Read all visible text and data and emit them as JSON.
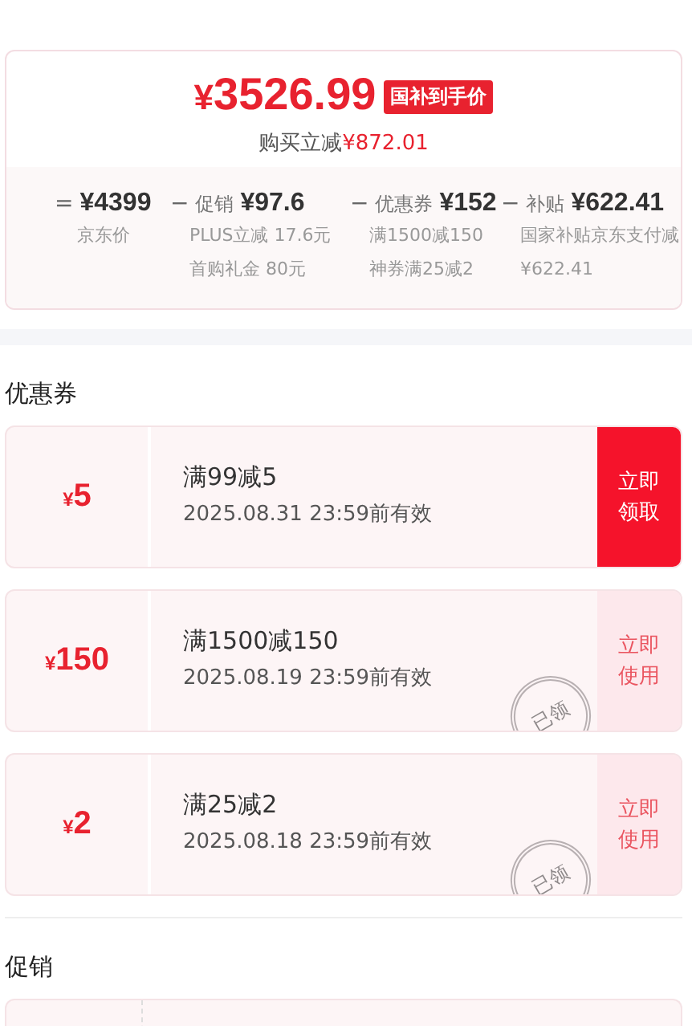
{
  "price": {
    "currency": "¥",
    "amount": "3526.99",
    "badge": "国补到手价",
    "saving_label": "购买立减",
    "saving_value": "¥872.01"
  },
  "breakdown": [
    {
      "operator": "=",
      "amount": "¥4399",
      "notes": [
        "京东价"
      ]
    },
    {
      "operator": "−",
      "label": "促销",
      "amount": "¥97.6",
      "notes": [
        "PLUS立减 17.6元",
        "首购礼金 80元"
      ]
    },
    {
      "operator": "−",
      "label": "优惠券",
      "amount": "¥152",
      "notes": [
        "满1500减150",
        "神券满25减2"
      ]
    },
    {
      "operator": "−",
      "label": "补贴",
      "amount": "¥622.41",
      "notes": [
        "国家补贴京东支付减¥622.41"
      ]
    }
  ],
  "coupons_section": {
    "title": "优惠券",
    "coupons": [
      {
        "currency": "¥",
        "value": "5",
        "condition": "满99减5",
        "validity": "2025.08.31  23:59前有效",
        "kind": "claim",
        "button": [
          "立即",
          "领取"
        ]
      },
      {
        "currency": "¥",
        "value": "150",
        "condition": "满1500减150",
        "validity": "2025.08.19 23:59前有效",
        "kind": "use",
        "button": [
          "立即",
          "使用"
        ],
        "stamp": "已领"
      },
      {
        "currency": "¥",
        "value": "2",
        "condition": "满25减2",
        "validity": "2025.08.18 23:59前有效",
        "kind": "use",
        "button": [
          "立即",
          "使用"
        ],
        "stamp": "已领"
      }
    ]
  },
  "promotions_section": {
    "title": "促销"
  }
}
